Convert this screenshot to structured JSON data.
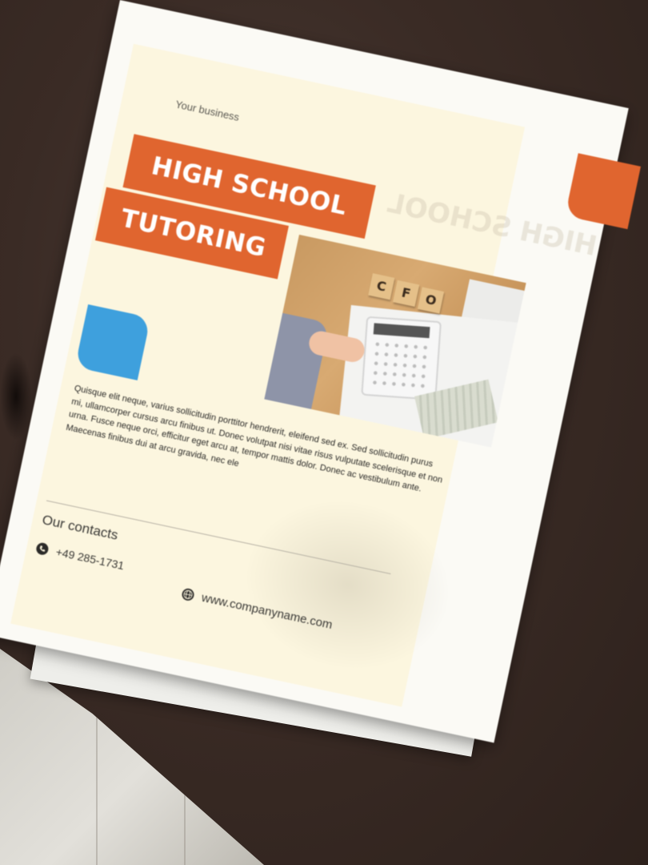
{
  "flyer": {
    "business_label": "Your business",
    "headline_line1": "HIGH SCHOOL",
    "headline_line2": "TUTORING",
    "photo": {
      "cube_letters": [
        "C",
        "F",
        "O"
      ]
    },
    "body_text": "Quisque elit neque, varius sollicitudin porttitor hendrerit, eleifend sed ex. Sed sollicitudin purus mi, ullamcorper cursus arcu finibus ut. Donec volutpat nisi vitae risus vulputate scelerisque et non urna. Fusce neque orci, efficitur eget arcu at, tempor mattis dolor. Donec ac vestibulum ante. Maecenas finibus dui at arcu gravida, nec ele",
    "contacts": {
      "title": "Our contacts",
      "phone_icon": "phone-icon",
      "phone": "+49 285-1731",
      "web_icon": "globe-icon",
      "website": "www.companyname.com"
    }
  },
  "colors": {
    "accent_orange": "#e0652f",
    "accent_blue": "#3ea0dd",
    "panel_cream": "#fcf6df",
    "table_wood": "#3a2b25"
  }
}
